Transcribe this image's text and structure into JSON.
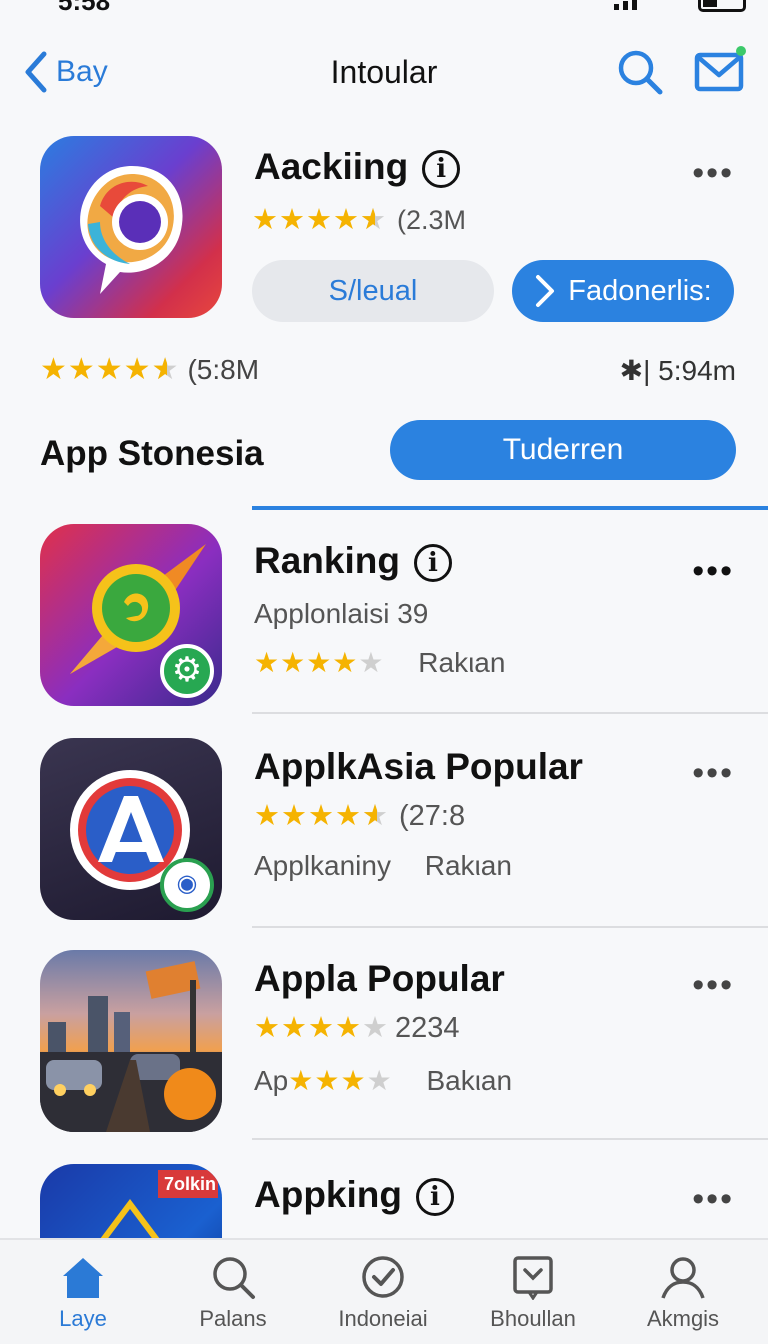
{
  "status_bar": {
    "time": "5:58"
  },
  "nav": {
    "back_label": "Bay",
    "title": "Intoular"
  },
  "featured": {
    "name": "Aackiing",
    "rating_stars": 4.5,
    "rating_count": "(2.3M",
    "secondary_button": "S/leual",
    "primary_button": "Fadonerlis:"
  },
  "summary": {
    "rating_stars": 4.5,
    "rating_value": "(5:8M",
    "right_value": "5:94m",
    "right_icon": "✱|"
  },
  "section": {
    "title": "App Stonesia",
    "button_label": "Tuderren"
  },
  "apps": [
    {
      "name": "Ranking",
      "line2": "Applonlaisi   39",
      "rating_stars": 4,
      "line3_text": "Rakιan",
      "icon": "compass-app-icon"
    },
    {
      "name": "ApplkAsia Popular",
      "rating_stars": 4.5,
      "rating_count": "(27:8",
      "line3a": "Applkaniny",
      "line3b": "Rakιan",
      "icon": "a-logo-app-icon"
    },
    {
      "name": "Appla Popular",
      "rating_stars": 4,
      "rating_count": "2234",
      "line3a": "Ap",
      "line3b": "Bakιan",
      "icon": "city-photo-app-icon"
    },
    {
      "name": "Appking",
      "icon": "sign-app-icon",
      "badge_text": "7olkin"
    }
  ],
  "tabs": [
    {
      "label": "Laye",
      "icon": "home-icon",
      "active": true
    },
    {
      "label": "Palans",
      "icon": "search-icon",
      "active": false
    },
    {
      "label": "Indoneiai",
      "icon": "check-circle-icon",
      "active": false
    },
    {
      "label": "Bhoullan",
      "icon": "download-box-icon",
      "active": false
    },
    {
      "label": "Akmgis",
      "icon": "person-icon",
      "active": false
    }
  ],
  "colors": {
    "accent": "#2b82e0",
    "star": "#f5b301",
    "badge_green": "#27a852"
  }
}
